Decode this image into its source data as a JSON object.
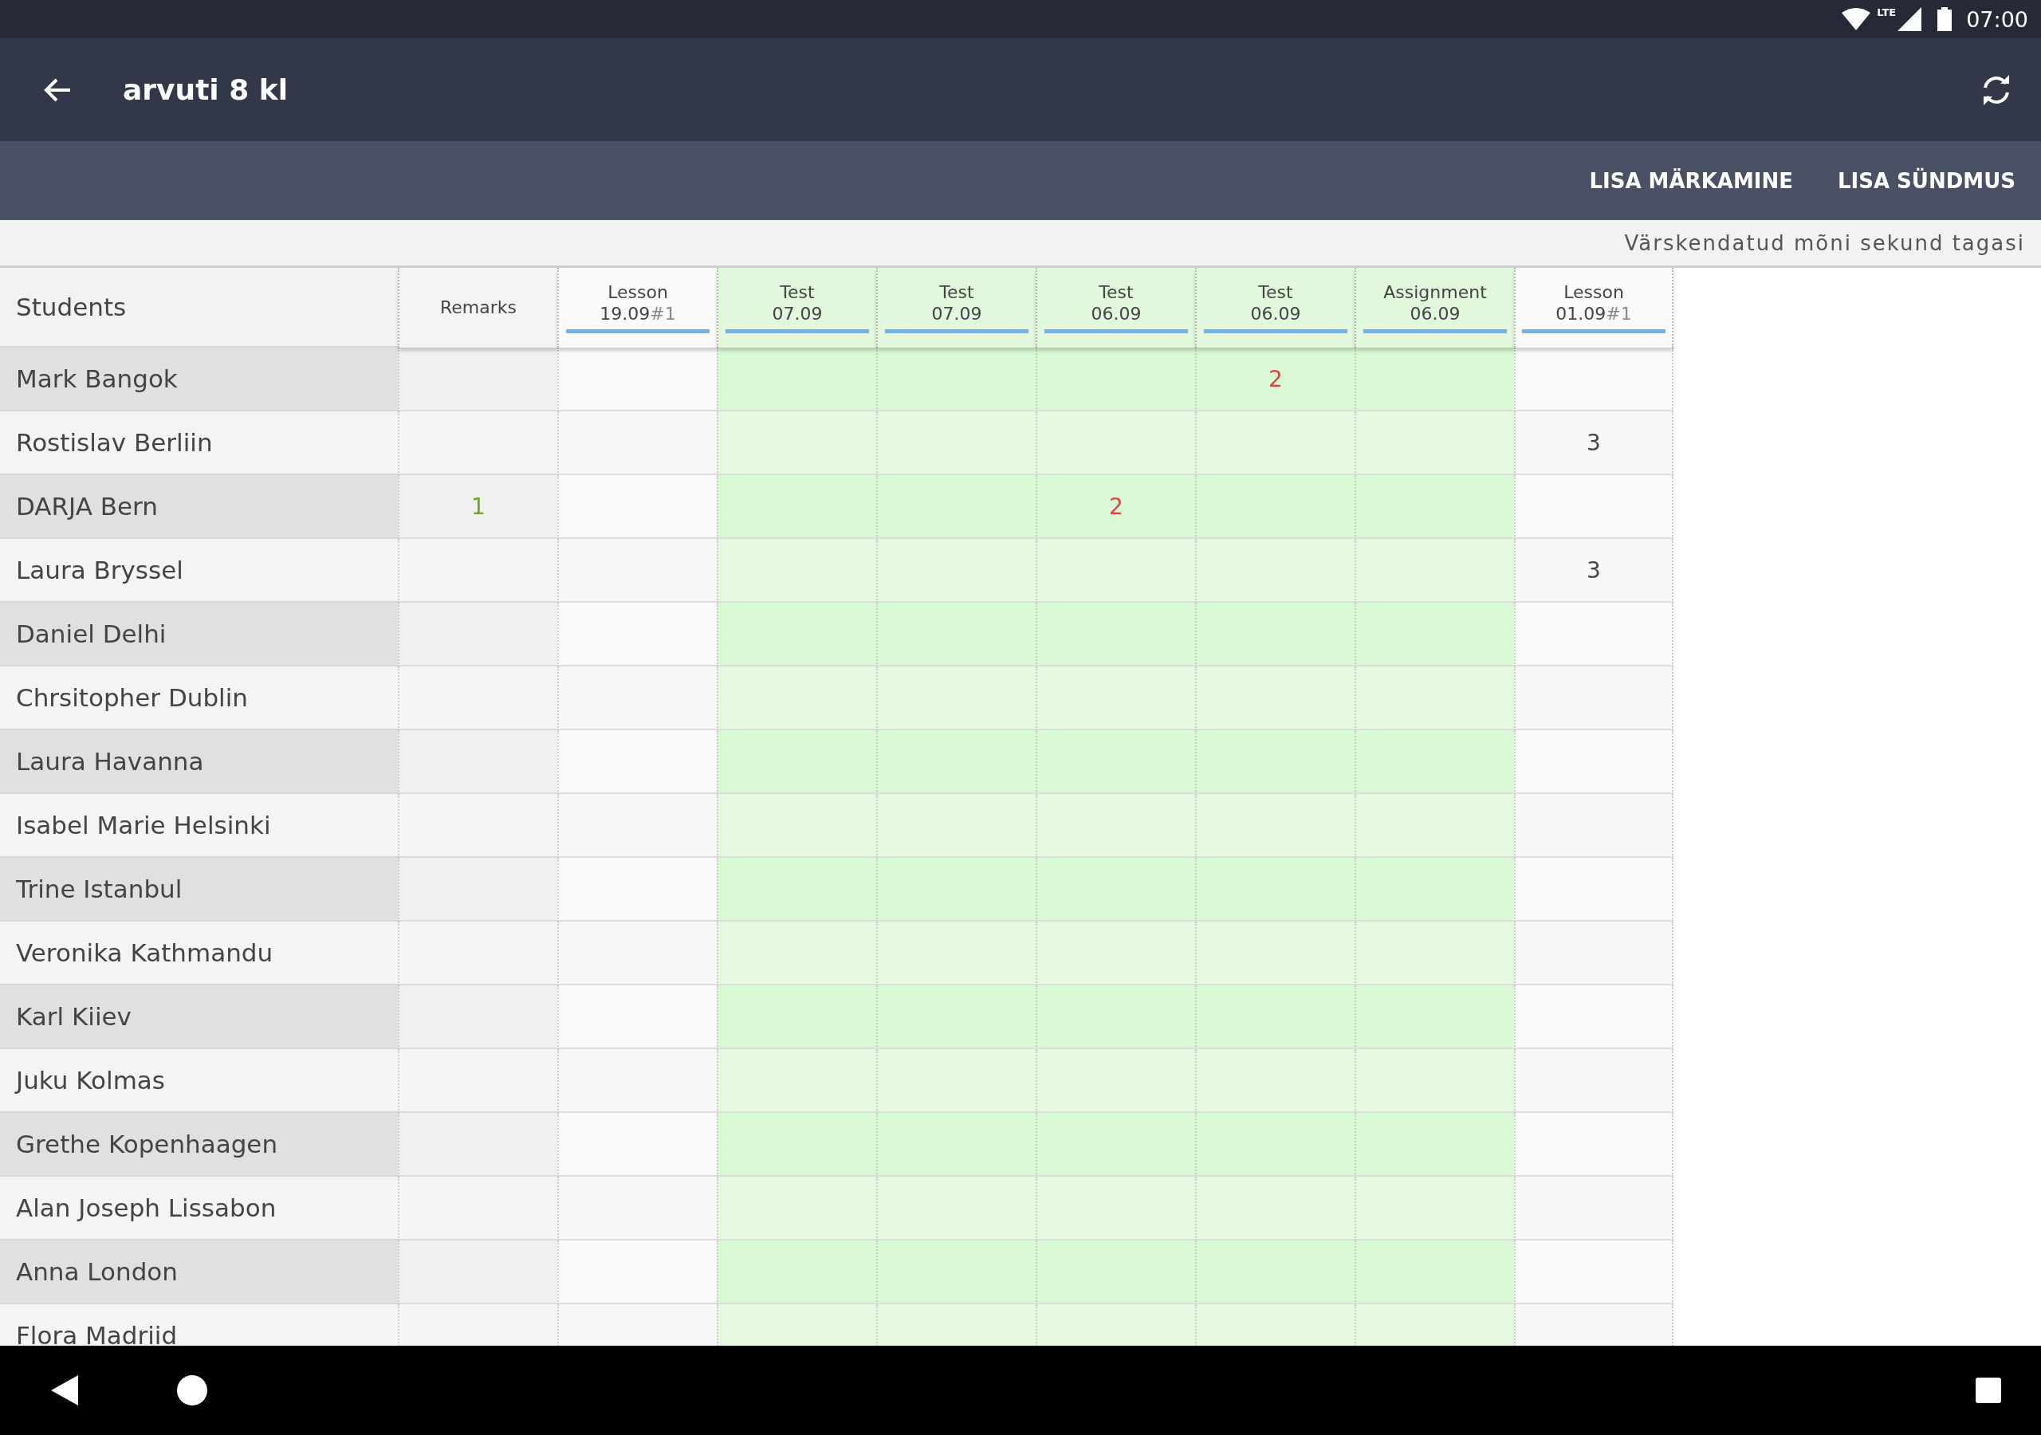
{
  "status_bar": {
    "network": "LTE",
    "time": "07:00"
  },
  "app_bar": {
    "title": "arvuti 8 kl"
  },
  "actions": [
    "LISA MÄRKAMINE",
    "LISA SÜNDMUS"
  ],
  "update_note": "Värskendatud mõni sekund tagasi",
  "table": {
    "students_header": "Students",
    "columns": [
      {
        "kind": "remarks",
        "type": "Remarks"
      },
      {
        "kind": "lesson",
        "type": "Lesson",
        "date": "19.09",
        "number": "#1"
      },
      {
        "kind": "test",
        "type": "Test",
        "date": "07.09"
      },
      {
        "kind": "test",
        "type": "Test",
        "date": "07.09"
      },
      {
        "kind": "test",
        "type": "Test",
        "date": "06.09"
      },
      {
        "kind": "test",
        "type": "Test",
        "date": "06.09"
      },
      {
        "kind": "assignment",
        "type": "Assignment",
        "date": "06.09"
      },
      {
        "kind": "lesson",
        "type": "Lesson",
        "date": "01.09",
        "number": "#1"
      }
    ],
    "rows": [
      {
        "name": "Mark Bangok",
        "cells": [
          null,
          null,
          null,
          null,
          null,
          {
            "text": "2",
            "color": "#f03c3c"
          },
          null,
          null
        ]
      },
      {
        "name": "Rostislav Berliin",
        "cells": [
          null,
          null,
          null,
          null,
          null,
          null,
          null,
          {
            "text": "3",
            "color": "#444444"
          }
        ]
      },
      {
        "name": "DARJA Bern",
        "cells": [
          {
            "text": "1",
            "color": "#6aa51e"
          },
          null,
          null,
          null,
          {
            "text": "2",
            "color": "#f03c3c"
          },
          null,
          null,
          null
        ]
      },
      {
        "name": "Laura Bryssel",
        "cells": [
          null,
          null,
          null,
          null,
          null,
          null,
          null,
          {
            "text": "3",
            "color": "#444444"
          }
        ]
      },
      {
        "name": "Daniel Delhi",
        "cells": [
          null,
          null,
          null,
          null,
          null,
          null,
          null,
          null
        ]
      },
      {
        "name": "Chrsitopher Dublin",
        "cells": [
          null,
          null,
          null,
          null,
          null,
          null,
          null,
          null
        ]
      },
      {
        "name": "Laura Havanna",
        "cells": [
          null,
          null,
          null,
          null,
          null,
          null,
          null,
          null
        ]
      },
      {
        "name": "Isabel Marie Helsinki",
        "cells": [
          null,
          null,
          null,
          null,
          null,
          null,
          null,
          null
        ]
      },
      {
        "name": "Trine Istanbul",
        "cells": [
          null,
          null,
          null,
          null,
          null,
          null,
          null,
          null
        ]
      },
      {
        "name": "Veronika Kathmandu",
        "cells": [
          null,
          null,
          null,
          null,
          null,
          null,
          null,
          null
        ]
      },
      {
        "name": "Karl Kiiev",
        "cells": [
          null,
          null,
          null,
          null,
          null,
          null,
          null,
          null
        ]
      },
      {
        "name": "Juku Kolmas",
        "cells": [
          null,
          null,
          null,
          null,
          null,
          null,
          null,
          null
        ]
      },
      {
        "name": "Grethe Kopenhaagen",
        "cells": [
          null,
          null,
          null,
          null,
          null,
          null,
          null,
          null
        ]
      },
      {
        "name": "Alan Joseph Lissabon",
        "cells": [
          null,
          null,
          null,
          null,
          null,
          null,
          null,
          null
        ]
      },
      {
        "name": "Anna London",
        "cells": [
          null,
          null,
          null,
          null,
          null,
          null,
          null,
          null
        ]
      },
      {
        "name": "Flora Madriid",
        "cells": [
          null,
          null,
          null,
          null,
          null,
          null,
          null,
          null
        ]
      }
    ]
  }
}
